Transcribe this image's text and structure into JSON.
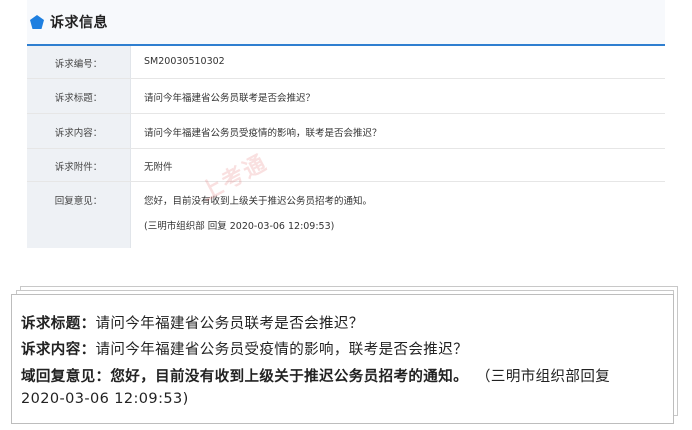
{
  "panel": {
    "title": "诉求信息",
    "accent_color": "#2f7fd0",
    "icon": "pentagon-icon",
    "rows": [
      {
        "label": "诉求编号：",
        "value": "SM20030510302"
      },
      {
        "label": "诉求标题：",
        "value": "请问今年福建省公务员联考是否会推迟？"
      },
      {
        "label": "诉求内容：",
        "value": "请问今年福建省公务员受疫情的影响，联考是否会推迟？"
      },
      {
        "label": "诉求附件：",
        "value": "无附件"
      },
      {
        "label": "回复意见：",
        "value": "您好，目前没有收到上级关于推迟公务员招考的通知。",
        "value2": "(三明市组织部 回复 2020-03-06 12:09:53)"
      }
    ],
    "watermark": "上考通"
  },
  "summary": {
    "title_label": "诉求标题：",
    "title_value": "请问今年福建省公务员联考是否会推迟？",
    "content_label": "诉求内容：",
    "content_value": "请问今年福建省公务员受疫情的影响，联考是否会推迟？",
    "reply_label": "域回复意见：",
    "reply_value": "您好，目前没有收到上级关于推迟公务员招考的通知。",
    "reply_source": "（三明市组织部回复",
    "reply_time": "2020-03-06 12:09:53)"
  }
}
